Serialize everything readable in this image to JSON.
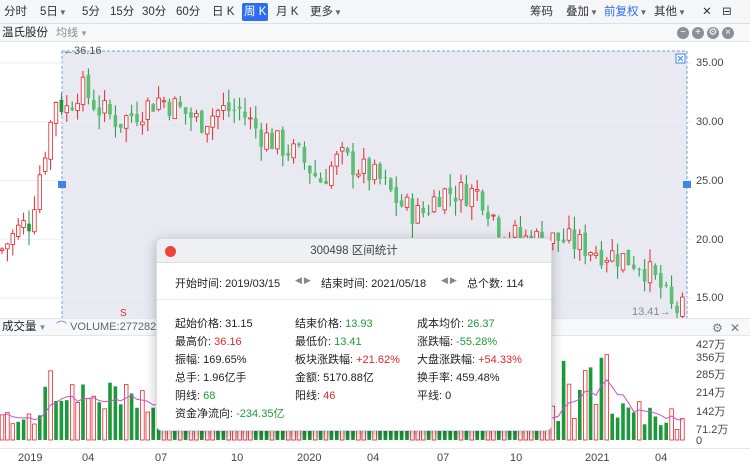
{
  "toolbar": {
    "left_items": [
      "分时",
      "5日",
      "5分",
      "15分",
      "30分",
      "60分",
      "日 K",
      "周 K",
      "月 K",
      "更多"
    ],
    "active": "周 K",
    "right_items": [
      "筹码",
      "叠加",
      "前复权",
      "其他"
    ],
    "accent_color": "#2d6ef0"
  },
  "header": {
    "stock_name": "温氏股份",
    "ma_label": "均线",
    "max_price_label": "36.16",
    "min_price_label": "13.41"
  },
  "price_axis": [
    "35.00",
    "30.00",
    "25.00",
    "20.00",
    "15.00"
  ],
  "volume_header": {
    "title": "成交量",
    "volume_text": "VOLUME:277282.000"
  },
  "volume_axis": [
    "427万",
    "356万",
    "285万",
    "214万",
    "142万",
    "71.2万",
    "0"
  ],
  "date_axis": [
    "2019",
    "04",
    "07",
    "10",
    "2020",
    "04",
    "07",
    "10",
    "2021",
    "04"
  ],
  "popup": {
    "title": "300498 区间统计",
    "start_time": "开始时间: 2019/03/15",
    "end_time": "结束时间: 2021/05/18",
    "total": "总个数: 114",
    "stats": {
      "start_price_label": "起始价格: ",
      "start_price": "31.15",
      "end_price_label": "结束价格: ",
      "end_price": "13.93",
      "avg_cost_label": "成本均价: ",
      "avg_cost": "26.37",
      "high_label": "最高价: ",
      "high": "36.16",
      "low_label": "最低价: ",
      "low": "13.41",
      "change_label": "涨跌幅: ",
      "change": "-55.28%",
      "amplitude": "振幅: 169.65%",
      "sector_label": "板块涨跌幅: ",
      "sector": "+21.62%",
      "market_label": "大盘涨跌幅: ",
      "market": "+54.33%",
      "total_hands": "总手: 1.96亿手",
      "amount": "金额: 5170.88亿",
      "turnover": "换手率: 459.48%",
      "down_label": "阴线: ",
      "down": "68",
      "up_label": "阳线: ",
      "up": "46",
      "flat": "平线: 0",
      "net_flow_label": "资金净流向: ",
      "net_flow": "-234.35亿"
    }
  },
  "colors": {
    "up": "#e3262d",
    "down": "#1b9a3b",
    "selection": "#e9e9f2"
  }
}
